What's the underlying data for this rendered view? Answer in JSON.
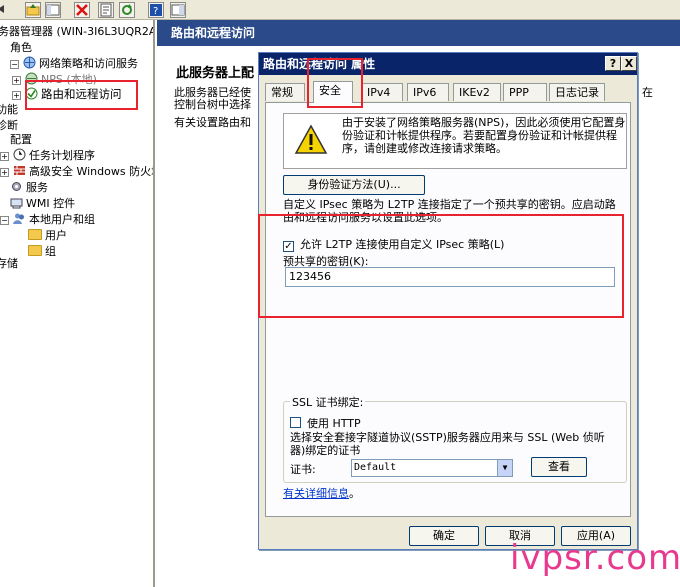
{
  "tree": {
    "root": "务器管理器 (WIN-3I6L3UQR2A",
    "roles": "角色",
    "npas": "网络策略和访问服务",
    "nps": "NPS (本地)",
    "rras": "路由和远程访问",
    "features": "功能",
    "diagnostics": "诊断",
    "config": "配置",
    "task_scheduler": "任务计划程序",
    "firewall": "高级安全 Windows 防火增",
    "services": "服务",
    "wmi": "WMI 控件",
    "local_users": "本地用户和组",
    "users": "用户",
    "groups": "组",
    "storage": "存储"
  },
  "pane": {
    "header": "路由和远程访问",
    "title": "此服务器上配",
    "line1": "此服务器已经使",
    "line2": "控制台树中选择",
    "line3": "有关设置路由和",
    "line_right": "在"
  },
  "dialog": {
    "title": "路由和远程访问 属性",
    "help_btn": "?",
    "close_btn": "X",
    "tabs": [
      "常规",
      "安全",
      "IPv4",
      "IPv6",
      "IKEv2",
      "PPP",
      "日志记录"
    ],
    "info_text": "由于安装了网络策略服务器(NPS)，因此必须使用它配置身份验证和计帐提供程序。若要配置身份验证和计帐提供程序，请创建或修改连接请求策略。",
    "auth_button": "身份验证方法(U)...",
    "ipsec_desc": "自定义 IPsec 策略为 L2TP 连接指定了一个预共享的密钥。应启动路由和远程访问服务以设置此选项。",
    "allow_l2tp_label": "允许 L2TP 连接使用自定义 IPsec 策略(L)",
    "allow_l2tp_checked": "✓",
    "psk_label": "预共享的密钥(K):",
    "psk_value": "123456",
    "ssl_group_title": "SSL 证书绑定:",
    "use_http_label": "使用 HTTP",
    "sstp_desc": "选择安全套接字隧道协议(SSTP)服务器应用来与 SSL (Web 侦听器)绑定的证书",
    "cert_label": "证书:",
    "cert_value": "Default",
    "view_button": "查看",
    "more_info_link": "有关详细信息",
    "more_info_suffix": "。",
    "ok_button": "确定",
    "cancel_button": "取消",
    "apply_button": "应用(A)"
  },
  "watermark": "ivpsr.com"
}
